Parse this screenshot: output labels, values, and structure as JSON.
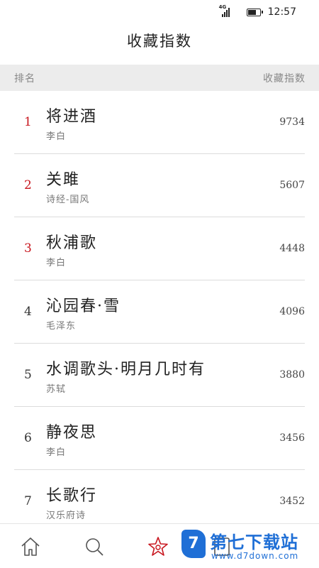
{
  "status_bar": {
    "network": "4G",
    "time": "12:57",
    "battery_level": 0.75
  },
  "page": {
    "title": "收藏指数"
  },
  "table_header": {
    "rank_label": "排名",
    "count_label": "收藏指数"
  },
  "rows": [
    {
      "rank": "1",
      "title": "将进酒",
      "author": "李白",
      "count": "9734"
    },
    {
      "rank": "2",
      "title": "关雎",
      "author": "诗经-国风",
      "count": "5607"
    },
    {
      "rank": "3",
      "title": "秋浦歌",
      "author": "李白",
      "count": "4448"
    },
    {
      "rank": "4",
      "title": "沁园春·雪",
      "author": "毛泽东",
      "count": "4096"
    },
    {
      "rank": "5",
      "title": "水调歌头·明月几时有",
      "author": "苏轼",
      "count": "3880"
    },
    {
      "rank": "6",
      "title": "静夜思",
      "author": "李白",
      "count": "3456"
    },
    {
      "rank": "7",
      "title": "长歌行",
      "author": "汉乐府诗",
      "count": "3452"
    }
  ],
  "tab_bar": {
    "tabs": [
      {
        "icon": "home-icon",
        "active": false
      },
      {
        "icon": "search-icon",
        "active": false
      },
      {
        "icon": "star-icon",
        "active": true
      }
    ]
  },
  "watermark": {
    "name": "第七下载站",
    "url": "www.d7down.com",
    "logo_letter": "7"
  },
  "colors": {
    "accent": "#c8161e",
    "header_bg": "#ececec",
    "watermark_blue": "#1f6fd6"
  }
}
